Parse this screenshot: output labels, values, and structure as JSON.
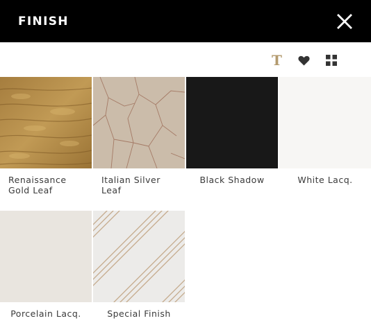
{
  "header": {
    "title": "FINISH",
    "close_icon": "close-x-icon"
  },
  "toolbar": {
    "text_view_glyph": "T",
    "text_view_icon": "text-t-icon",
    "favorites_icon": "heart-icon",
    "grid_view_icon": "grid-icon",
    "accent_color": "#b39a6e",
    "icon_color": "#333333"
  },
  "finishes": [
    {
      "name": "Renaissance Gold Leaf",
      "line1": "Renaissance",
      "line2": "Gold Leaf",
      "swatch": "gold-leaf-texture",
      "color": "#b08a45"
    },
    {
      "name": "Italian Silver Leaf",
      "line1": "Italian Silver",
      "line2": "Leaf",
      "swatch": "silver-leaf-texture",
      "color": "#c9b9a6"
    },
    {
      "name": "Black Shadow",
      "line1": "Black Shadow",
      "line2": "",
      "swatch": "solid-black",
      "color": "#181818"
    },
    {
      "name": "White Lacq.",
      "line1": "White Lacq.",
      "line2": "",
      "swatch": "solid-white",
      "color": "#f7f6f4"
    },
    {
      "name": "Porcelain Lacq.",
      "line1": "Porcelain Lacq.",
      "line2": "",
      "swatch": "solid-porcelain",
      "color": "#e9e5df"
    },
    {
      "name": "Special Finish",
      "line1": "Special Finish",
      "line2": "",
      "swatch": "diagonal-stripes",
      "color": "#c4a98b"
    }
  ]
}
